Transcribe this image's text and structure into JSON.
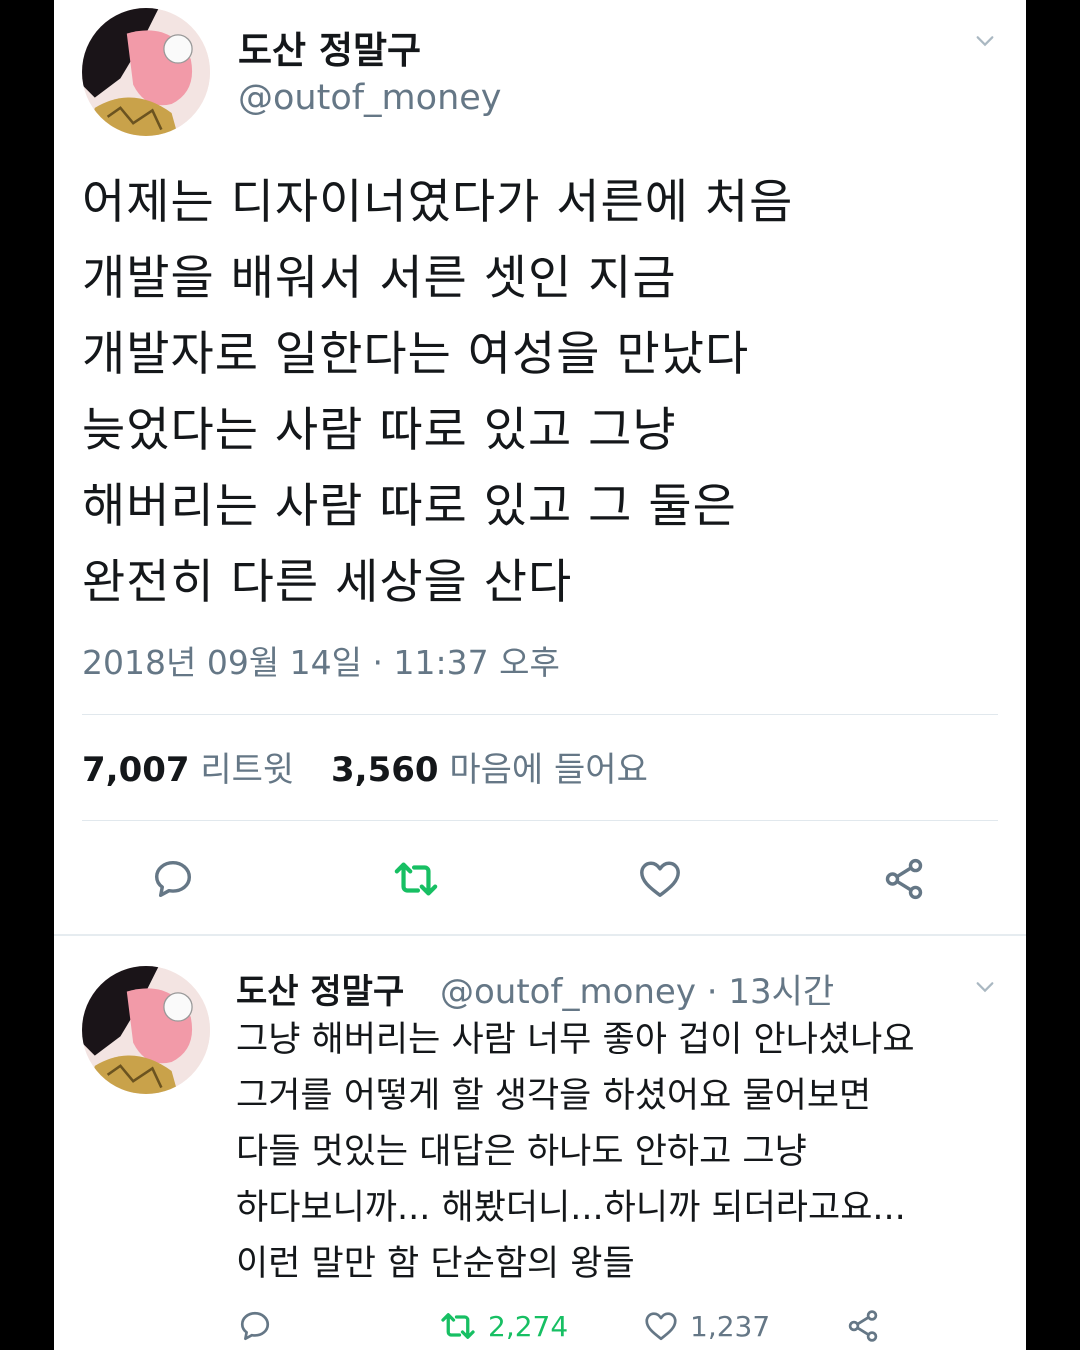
{
  "main_tweet": {
    "display_name": "도산 정말구",
    "handle": "@outof_money",
    "text_lines": [
      "어제는 디자이너였다가 서른에 처음",
      "개발을 배워서 서른 셋인 지금",
      "개발자로 일한다는 여성을 만났다",
      "늦었다는 사람 따로 있고 그냥",
      "해버리는 사람 따로 있고 그 둘은",
      "완전히 다른 세상을 산다"
    ],
    "timestamp": "2018년 09월 14일 · 11:37 오후",
    "retweet_count": "7,007",
    "retweet_label": "리트윗",
    "like_count": "3,560",
    "like_label": "마음에 들어요"
  },
  "reply": {
    "display_name": "도산 정말구",
    "handle_time": "@outof_money · 13시간",
    "text_lines": [
      "그냥 해버리는 사람 너무 좋아 겁이 안나셨나요",
      "그거를 어떻게 할 생각을 하셨어요 물어보면",
      "다들 멋있는 대답은 하나도 안하고 그냥",
      "하다보니까... 해봤더니...하니까 되더라고요...",
      "이런 말만 함 단순함의 왕들"
    ],
    "retweet_count": "2,274",
    "like_count": "1,237"
  },
  "icons": {
    "reply": "reply-icon",
    "retweet": "retweet-icon",
    "like": "heart-icon",
    "share": "share-icon",
    "more": "chevron-down-icon"
  },
  "colors": {
    "text": "#14171a",
    "secondary": "#657786",
    "retweet_green": "#17bf63",
    "divider": "#e1e8ed"
  }
}
